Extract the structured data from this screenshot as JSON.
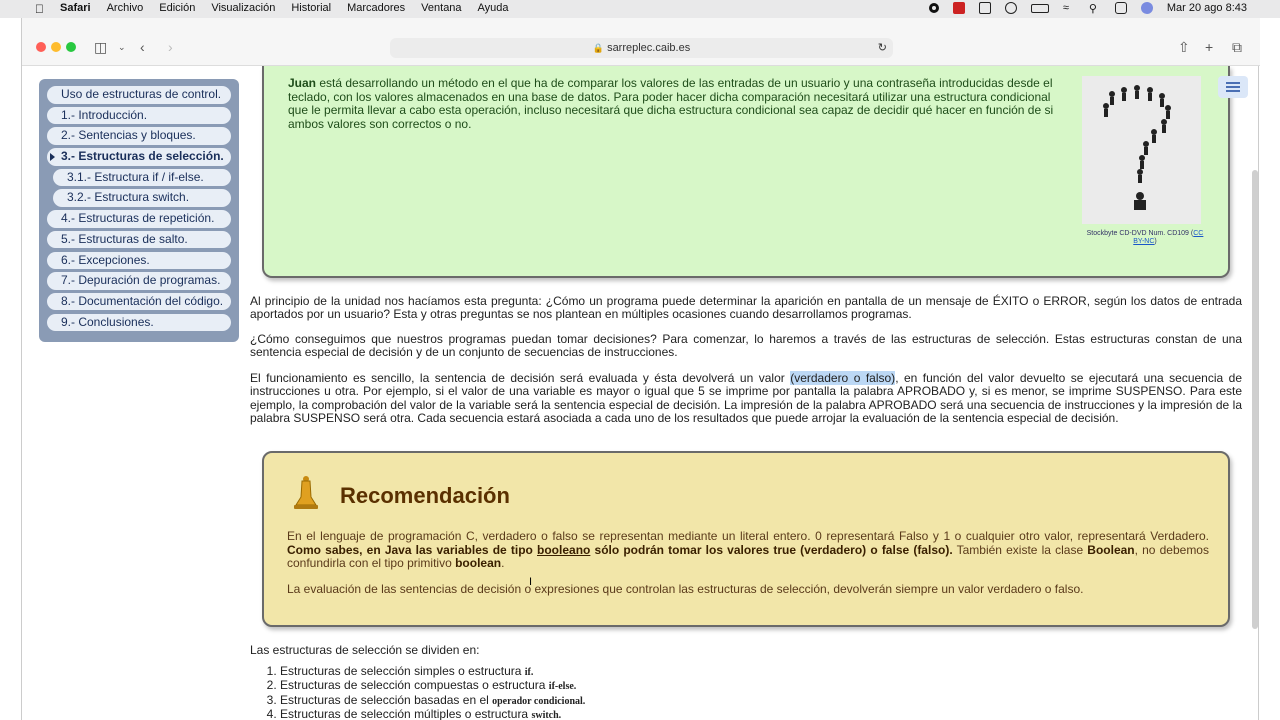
{
  "menubar": {
    "apple": "",
    "app": "Safari",
    "items": [
      "Archivo",
      "Edición",
      "Visualización",
      "Historial",
      "Marcadores",
      "Ventana",
      "Ayuda"
    ],
    "datetime": "Mar 20 ago 8:43"
  },
  "browser": {
    "url": "sarreplec.caib.es"
  },
  "sidebar": {
    "items": [
      {
        "label": "Uso de estructuras de control."
      },
      {
        "label": "1.- Introducción."
      },
      {
        "label": "2.- Sentencias y bloques."
      },
      {
        "label": "3.- Estructuras de selección."
      },
      {
        "label": "3.1.- Estructura if / if-else."
      },
      {
        "label": "3.2.- Estructura switch."
      },
      {
        "label": "4.- Estructuras de repetición."
      },
      {
        "label": "5.- Estructuras de salto."
      },
      {
        "label": "6.- Excepciones."
      },
      {
        "label": "7.- Depuración de programas."
      },
      {
        "label": "8.- Documentación del código."
      },
      {
        "label": "9.- Conclusiones."
      }
    ]
  },
  "greenbox": {
    "name": "Juan",
    "text": " está desarrollando un método en el que ha de comparar los valores de las entradas de un usuario y una contraseña introducidas desde el teclado, con los valores almacenados en una base de datos. Para poder hacer dicha comparación necesitará utilizar una estructura condicional que le permita llevar a cabo esta operación, incluso necesitará que dicha estructura condicional sea capaz de decidir qué hacer en función de si ambos valores son correctos o no.",
    "caption": "Stockbyte CD-DVD Num. CD109 (",
    "caption_link": "CC BY-NC",
    "caption_end": ")"
  },
  "paragraphs": {
    "p1": "Al principio de la unidad nos hacíamos esta pregunta: ¿Cómo un programa puede determinar la aparición en pantalla de un mensaje de ÉXITO o ERROR, según los datos de entrada aportados por un usuario? Esta y otras preguntas se nos plantean en múltiples ocasiones cuando desarrollamos programas.",
    "p2": "¿Cómo conseguimos que nuestros programas puedan tomar decisiones? Para comenzar, lo haremos a través de las estructuras de selección. Estas estructuras constan de una sentencia especial de decisión y de un conjunto de secuencias de instrucciones.",
    "p3a": "El funcionamiento es sencillo, la sentencia de decisión será evaluada y ésta devolverá un valor ",
    "p3hl": "(verdadero o falso)",
    "p3b": ", en función del valor devuelto se ejecutará una secuencia de instrucciones u otra. Por ejemplo, si el valor de una variable es mayor o igual que 5 se imprime por pantalla la palabra APROBADO y, si es menor, se imprime SUSPENSO. Para este ejemplo, la comprobación del valor de la variable será la sentencia especial de decisión. La impresión de la palabra APROBADO será una secuencia de instrucciones y la impresión de la palabra SUSPENSO será otra. Cada secuencia estará asociada a cada uno de los resultados que puede arrojar la evaluación de la sentencia especial de decisión."
  },
  "recommendation": {
    "title": "Recomendación",
    "t1": "En el lenguaje de programación C, verdadero o falso se representan mediante un literal entero. 0 representará Falso y 1 o cualquier otro valor, representará Verdadero. ",
    "t1b": "Como sabes, en Java las variables de tipo ",
    "t1c": " booleano",
    "t1d": " sólo podrán tomar los valores true (verdadero) o false (falso).",
    "t1e": " También existe la clase ",
    "t1f": "Boolean",
    "t1g": ", no debemos confundirla con el tipo primitivo ",
    "t1h": "boolean",
    "t1i": ".",
    "t2": "La evaluación de las sentencias de decisión o expresiones que controlan las estructuras de selección, devolverán siempre un valor verdadero o falso."
  },
  "list": {
    "intro": "Las estructuras de selección se dividen en:",
    "items": [
      {
        "text": "Estructuras de selección simples o estructura ",
        "code": "if."
      },
      {
        "text": "Estructuras de selección compuestas o estructura ",
        "code": "if-else."
      },
      {
        "text": "Estructuras de selección basadas en el ",
        "code": "operador condicional."
      },
      {
        "text": "Estructuras de selección múltiples o estructura ",
        "code": "switch."
      }
    ]
  }
}
